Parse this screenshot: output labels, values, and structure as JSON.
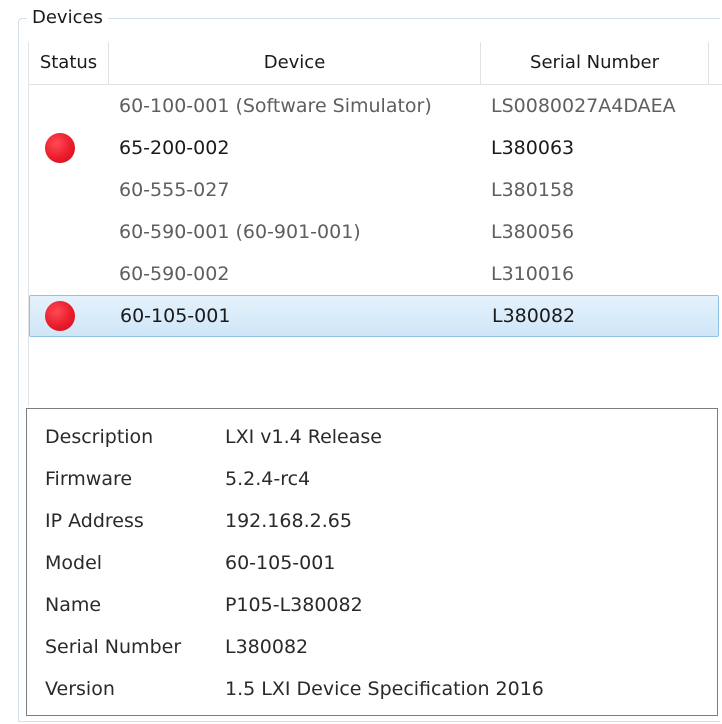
{
  "group": {
    "title": "Devices"
  },
  "columns": {
    "status": "Status",
    "device": "Device",
    "serial": "Serial Number"
  },
  "devices": [
    {
      "device": "60-100-001 (Software Simulator)",
      "serial": "LS0080027A4DAEA",
      "status": "none",
      "selected": false
    },
    {
      "device": "65-200-002",
      "serial": "L380063",
      "status": "red",
      "selected": false
    },
    {
      "device": "60-555-027",
      "serial": "L380158",
      "status": "none",
      "selected": false
    },
    {
      "device": "60-590-001 (60-901-001)",
      "serial": "L380056",
      "status": "none",
      "selected": false
    },
    {
      "device": "60-590-002",
      "serial": "L310016",
      "status": "none",
      "selected": false
    },
    {
      "device": "60-105-001",
      "serial": "L380082",
      "status": "red",
      "selected": true
    }
  ],
  "details": [
    {
      "label": "Description",
      "value": "LXI v1.4 Release"
    },
    {
      "label": "Firmware",
      "value": "5.2.4-rc4"
    },
    {
      "label": "IP Address",
      "value": "192.168.2.65"
    },
    {
      "label": "Model",
      "value": "60-105-001"
    },
    {
      "label": "Name",
      "value": "P105-L380082"
    },
    {
      "label": "Serial Number",
      "value": "L380082"
    },
    {
      "label": "Version",
      "value": "1.5 LXI Device Specification 2016"
    }
  ],
  "colors": {
    "status_red": "#e8192c",
    "selection_fill": "#d9ecfa",
    "selection_border": "#8ec1e6"
  },
  "icons": {
    "status": "red-status-dot-icon"
  }
}
